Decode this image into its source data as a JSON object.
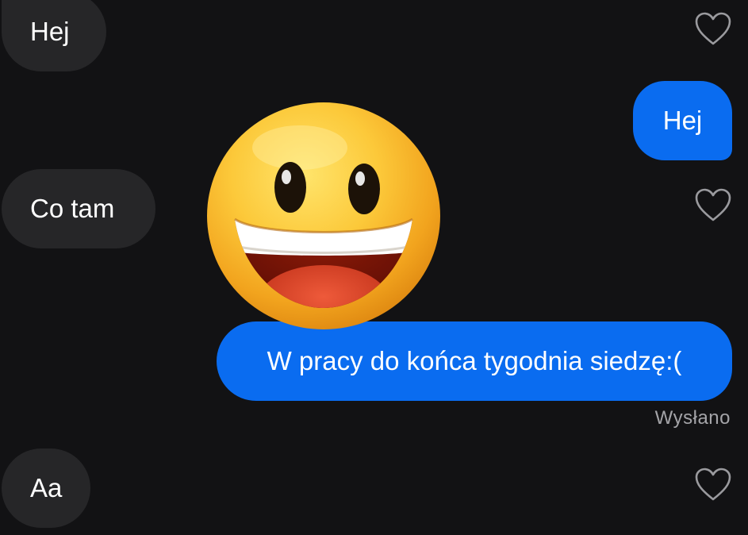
{
  "messages": {
    "m1": {
      "text": "Hej",
      "direction": "incoming"
    },
    "m2": {
      "text": "Hej",
      "direction": "outgoing"
    },
    "m3": {
      "text": "Co tam",
      "direction": "incoming"
    },
    "m4": {
      "text": "W pracy do końca tygodnia siedzę:(",
      "direction": "outgoing"
    },
    "m5": {
      "text": "Aa",
      "direction": "incoming"
    }
  },
  "status": {
    "text": "Wysłano"
  },
  "sticker": {
    "icon": "grinning-face-emoji"
  },
  "colors": {
    "background": "#121214",
    "incoming_bubble": "#262628",
    "outgoing_bubble": "#0a6cf0",
    "status_text": "#a4a4a8"
  }
}
